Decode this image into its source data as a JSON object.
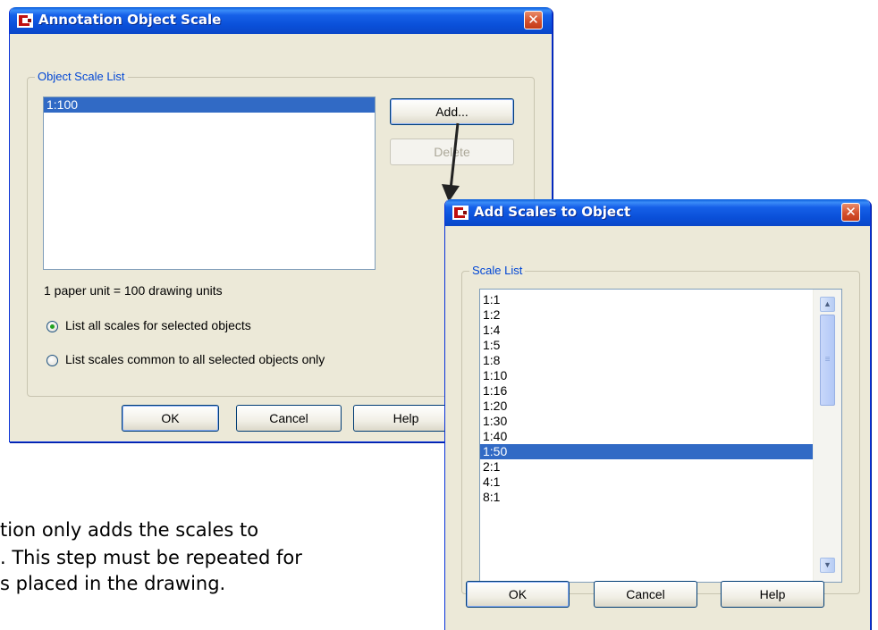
{
  "dialog1": {
    "title": "Annotation Object Scale",
    "close_symbol": "✕",
    "group_label": "Object Scale List",
    "scale_list": [
      "1:100"
    ],
    "add_button": "Add...",
    "delete_button": "Delete",
    "paper_unit_text": "1 paper unit = 100 drawing units",
    "radio_all": "List all scales for selected objects",
    "radio_common": "List scales common to all selected objects only",
    "ok_button": "OK",
    "cancel_button": "Cancel",
    "help_button": "Help"
  },
  "dialog2": {
    "title": "Add Scales to Object",
    "close_symbol": "✕",
    "group_label": "Scale List",
    "scales": [
      "1:1",
      "1:2",
      "1:4",
      "1:5",
      "1:8",
      "1:10",
      "1:16",
      "1:20",
      "1:30",
      "1:40",
      "1:50",
      "2:1",
      "4:1",
      "8:1"
    ],
    "selected_scale": "1:50",
    "ok_button": "OK",
    "cancel_button": "Cancel",
    "help_button": "Help"
  },
  "caption": {
    "line1": "tion only adds the scales to",
    "line2": ". This step must be repeated for",
    "line3": "s placed in the drawing."
  },
  "icons": {
    "app_icon": "autocad-logo-icon",
    "close": "close-icon",
    "scroll_up": "▲",
    "scroll_down": "▼",
    "thumb_grip": "≡"
  },
  "colors": {
    "titlebar": "#0a4fd8",
    "selection": "#316ac5",
    "group_label": "#0046d5",
    "dialog_bg": "#ece9d8"
  }
}
